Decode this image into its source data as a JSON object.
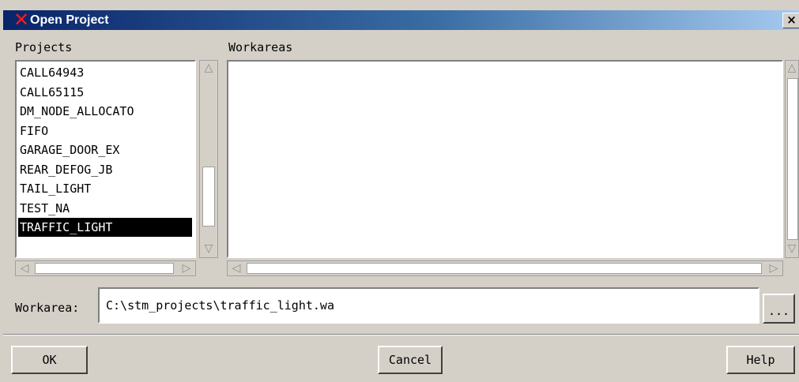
{
  "window": {
    "title": "Open Project",
    "app_icon": "x-logo-icon",
    "close_label": "×"
  },
  "projects": {
    "label": "Projects",
    "items": [
      "CALL64943",
      "CALL65115",
      "DM_NODE_ALLOCATO",
      "FIFO",
      "GARAGE_DOOR_EX",
      "REAR_DEFOG_JB",
      "TAIL_LIGHT",
      "TEST_NA",
      "TRAFFIC_LIGHT"
    ],
    "selected": "TRAFFIC_LIGHT"
  },
  "workareas": {
    "label": "Workareas",
    "items": []
  },
  "workarea_field": {
    "label": "Workarea:",
    "value": "C:\\stm_projects\\traffic_light.wa",
    "browse_label": "..."
  },
  "buttons": {
    "ok": "OK",
    "cancel": "Cancel",
    "help": "Help"
  },
  "colors": {
    "title_gradient_start": "#0a246a",
    "title_gradient_end": "#a6caf0",
    "face": "#d4d0c8",
    "selection": "#000000"
  }
}
